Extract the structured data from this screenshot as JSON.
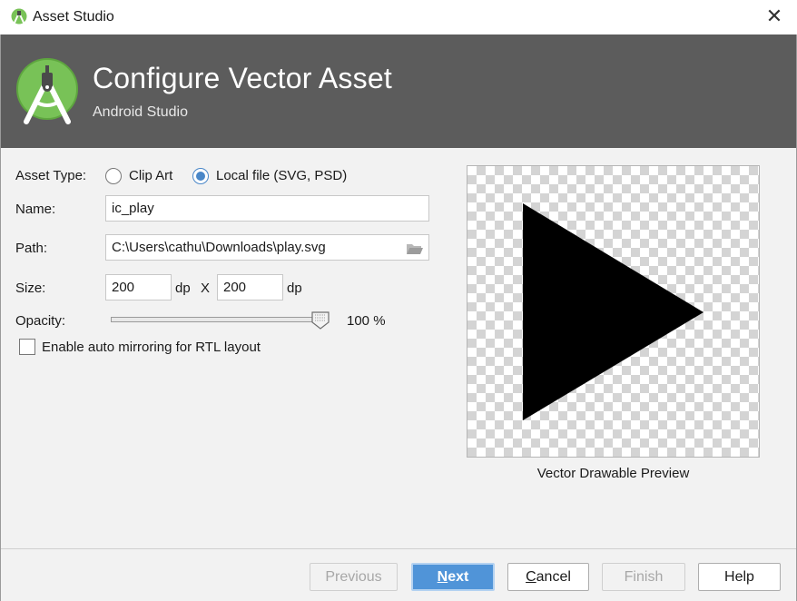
{
  "window": {
    "title": "Asset Studio",
    "close_glyph": "✕",
    "icon": "android-studio-icon"
  },
  "header": {
    "title": "Configure Vector Asset",
    "subtitle": "Android Studio",
    "logo": "android-studio-logo"
  },
  "form": {
    "asset_type_label": "Asset Type:",
    "asset_type_options": [
      {
        "label": "Clip Art",
        "selected": false
      },
      {
        "label": "Local file (SVG, PSD)",
        "selected": true
      }
    ],
    "name_label": "Name:",
    "name_value": "ic_play",
    "path_label": "Path:",
    "path_value": "C:\\Users\\cathu\\Downloads\\play.svg",
    "path_browse_icon": "folder-icon",
    "size_label": "Size:",
    "width_value": "200",
    "height_value": "200",
    "unit": "dp",
    "size_separator": "X",
    "opacity_label": "Opacity:",
    "opacity_value": 100,
    "opacity_text": "100 %",
    "auto_mirror_label": "Enable auto mirroring for RTL layout",
    "auto_mirror_checked": false
  },
  "preview": {
    "caption": "Vector Drawable Preview",
    "shape": "play-triangle",
    "shape_color": "#000000"
  },
  "buttons": {
    "previous": {
      "label": "Previous",
      "enabled": false
    },
    "next": {
      "mnemonic": "N",
      "rest": "ext",
      "enabled": true,
      "default": true
    },
    "cancel": {
      "mnemonic": "C",
      "rest": "ancel",
      "enabled": true
    },
    "finish": {
      "label": "Finish",
      "enabled": false
    },
    "help": {
      "label": "Help",
      "enabled": true
    }
  },
  "colors": {
    "header_bg": "#5c5c5c",
    "accent": "#4a87c8",
    "primary_button": "#5094d8",
    "android_green": "#78c257"
  }
}
